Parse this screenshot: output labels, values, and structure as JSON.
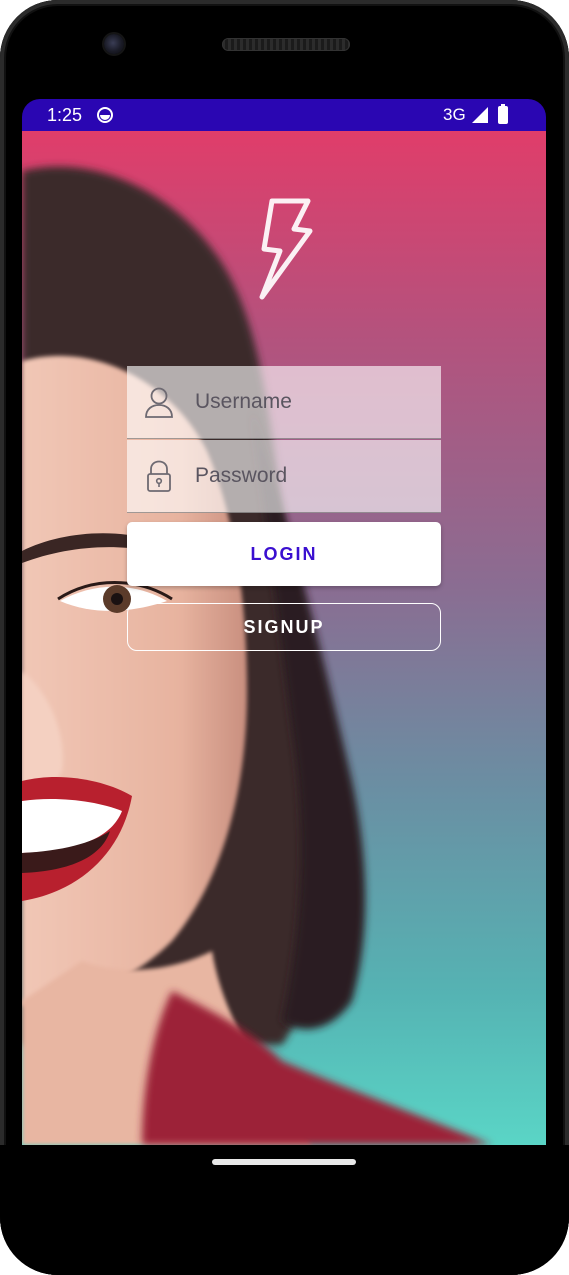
{
  "status_bar": {
    "time": "1:25",
    "network": "3G",
    "app_icon": "android-face-icon",
    "signal_icon": "signal-icon",
    "battery_icon": "battery-icon",
    "background_color": "#2a06b2"
  },
  "header": {
    "logo_icon": "lightning-bolt-icon"
  },
  "login_form": {
    "username": {
      "placeholder": "Username",
      "value": "",
      "icon": "user-icon"
    },
    "password": {
      "placeholder": "Password",
      "value": "",
      "icon": "lock-icon"
    },
    "login_label": "LOGIN",
    "signup_label": "SIGNUP"
  },
  "theme": {
    "gradient_top": "#e03d6a",
    "gradient_bottom": "#5ad5c6",
    "accent": "#3a0fd0"
  }
}
